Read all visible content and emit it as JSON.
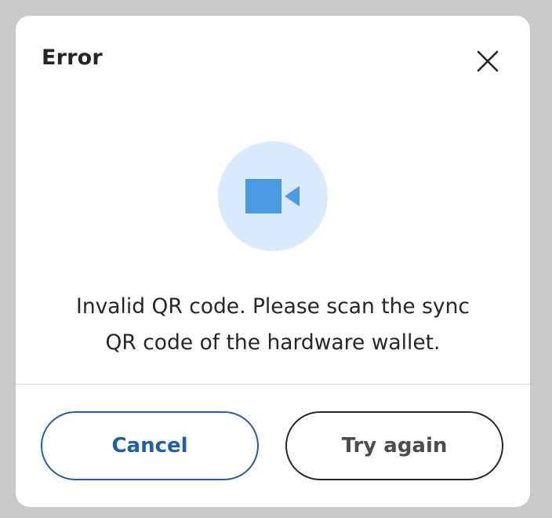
{
  "modal": {
    "title": "Error",
    "close_icon": "close-icon",
    "illustration_icon": "video-camera-icon",
    "message": "Invalid QR code. Please scan the sync QR code of the hardware wallet.",
    "message_lines": [
      "Invalid QR code. Please scan the sync",
      "QR code of the hardware wallet."
    ],
    "buttons": {
      "cancel_label": "Cancel",
      "retry_label": "Try again"
    },
    "colors": {
      "primary": "#1f5ea8",
      "icon_blue": "#4a9be3",
      "icon_bg": "#d8eafb",
      "text": "#24272a",
      "overlay": "#c9c9cc"
    }
  }
}
